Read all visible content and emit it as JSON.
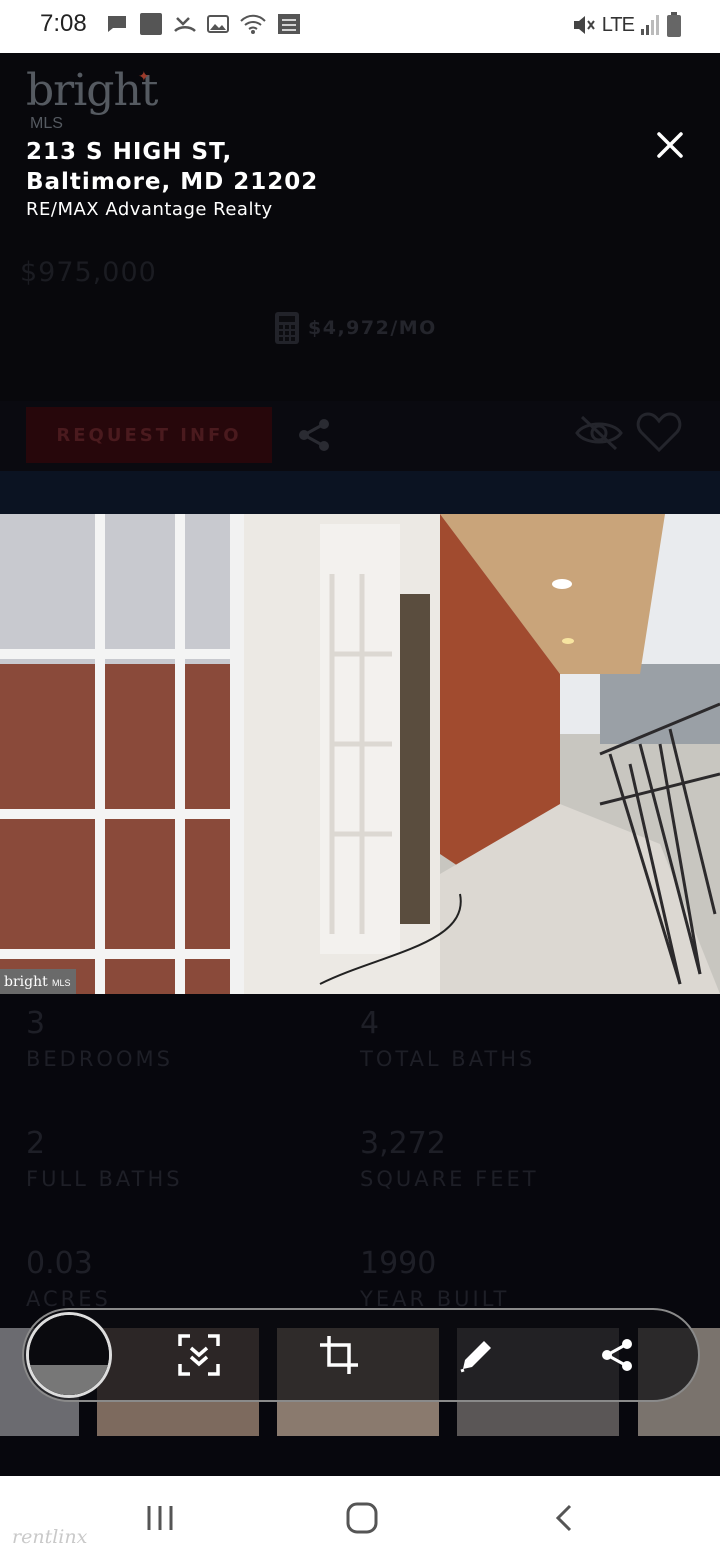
{
  "status_bar": {
    "time": "7:08",
    "network": "LTE",
    "icons": [
      "message-icon",
      "square-icon",
      "missed-call-icon",
      "image-icon",
      "wifi-icon",
      "calendar-icon",
      "mute-icon",
      "signal-icon",
      "battery-icon"
    ]
  },
  "overlay": {
    "address_line1": "213 S HIGH ST,",
    "address_line2": "Baltimore, MD 21202",
    "broker": "RE/MAX Advantage Realty",
    "close_icon": "close-icon"
  },
  "listing": {
    "logo_text": "bright",
    "logo_sub": "MLS",
    "price": "$975,000",
    "monthly": "$4,972/MO",
    "request_label": "REQUEST INFO",
    "photo_watermark": "bright",
    "photo_watermark_sub": "MLS",
    "stats": [
      {
        "value": "3",
        "label": "BEDROOMS"
      },
      {
        "value": "4",
        "label": "TOTAL BATHS"
      },
      {
        "value": "2",
        "label": "FULL BATHS"
      },
      {
        "value": "3,272",
        "label": "SQUARE FEET"
      },
      {
        "value": "0.03",
        "label": "ACRES"
      },
      {
        "value": "1990",
        "label": "YEAR BUILT"
      }
    ]
  },
  "screenshot_toolbar": {
    "buttons": [
      "scroll-capture-icon",
      "crop-icon",
      "edit-icon",
      "share-icon"
    ]
  },
  "nav_bar": {
    "buttons": [
      "recents-icon",
      "home-icon",
      "back-icon"
    ]
  },
  "watermark": "rentlinx"
}
